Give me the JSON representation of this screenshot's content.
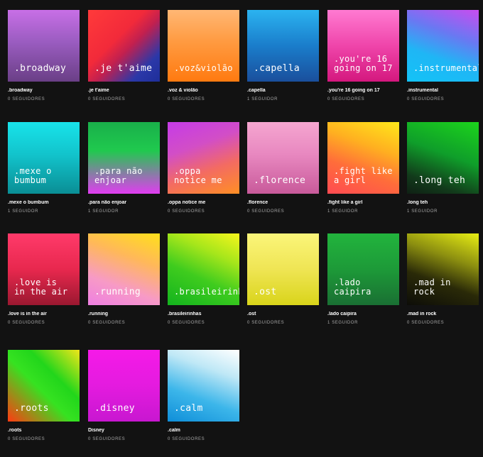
{
  "playlists": [
    {
      "cover": ".broadway",
      "title": ".broadway",
      "followers": "0 SEGUIDORES",
      "bg": "linear-gradient(180deg, #c86fe6 0%, #9a5cc0 45%, #6a3f86 100%)"
    },
    {
      "cover": ".je t'aime",
      "title": ".je t'aime",
      "followers": "0 SEGUIDORES",
      "bg": "linear-gradient(135deg, #ff3a3a 0%, #f22a3a 40%, #c2204f 55%, #2b38a8 80%, #1e2e9a 100%)"
    },
    {
      "cover": ".voz&violão",
      "title": ".voz & violão",
      "followers": "0 SEGUIDORES",
      "bg": "linear-gradient(180deg, #ffb774 0%, #ff9a40 45%, #ff7a10 100%)"
    },
    {
      "cover": ".capella",
      "title": ".capella",
      "followers": "1 SEGUIDOR",
      "bg": "linear-gradient(180deg, #2bb3f0 0%, #1a7dcb 50%, #1a4f9c 100%)"
    },
    {
      "cover": ".you're 16\ngoing on 17",
      "title": ".you're 16 going on 17",
      "followers": "0 SEGUIDORES",
      "bg": "linear-gradient(180deg, #ff7ad1 0%, #ef45aa 50%, #d4187e 100%)"
    },
    {
      "cover": ".instrumental",
      "title": ".instrumental",
      "followers": "0 SEGUIDORES",
      "bg": "linear-gradient(200deg, #c94cf0 0%, #6a78f2 35%, #1fb6f5 65%, #13c3f7 100%)"
    },
    {
      "cover": ".mexe o\nbumbum",
      "title": ".mexe o bumbum",
      "followers": "1 SEGUIDOR",
      "bg": "linear-gradient(180deg, #18e3ea 0%, #12c4cc 45%, #0a8e95 100%)"
    },
    {
      "cover": ".para não\nenjoar",
      "title": ".para não enjoar",
      "followers": "1 SEGUIDOR",
      "bg": "linear-gradient(180deg, #19b04a 0%, #20c94e 40%, #e13cf1 100%)"
    },
    {
      "cover": ".oppa\nnotice me",
      "title": ".oppa notice me",
      "followers": "0 SEGUIDORES",
      "bg": "linear-gradient(160deg, #c63be8 0%, #d24ec6 35%, #f36b62 65%, #ff8f24 100%)"
    },
    {
      "cover": ".florence",
      "title": ".florence",
      "followers": "0 SEGUIDORES",
      "bg": "linear-gradient(180deg, #f5a6d0 0%, #e888c0 45%, #c85a9a 100%)"
    },
    {
      "cover": ".fight like\na girl",
      "title": ".fight like a girl",
      "followers": "1 SEGUIDOR",
      "bg": "linear-gradient(200deg, #ffe81a 0%, #ffb020 35%, #ff6d3a 65%, #ff4a52 100%)"
    },
    {
      "cover": ".long teh",
      "title": ".long teh",
      "followers": "1 SEGUIDOR",
      "bg": "linear-gradient(200deg, #1cd41c 0%, #0f9e2a 45%, #123b1b 80%, #0f2014 100%)"
    },
    {
      "cover": ".love is\nin the air",
      "title": ".love is in the air",
      "followers": "0 SEGUIDORES",
      "bg": "linear-gradient(180deg, #ff3a6a 0%, #e8284e 50%, #9a1830 100%)"
    },
    {
      "cover": ".running",
      "title": ".running",
      "followers": "0 SEGUIDORES",
      "bg": "linear-gradient(200deg, #ffe01a 0%, #ffb85a 35%, #f79ac6 70%, #ee7fe2 100%)"
    },
    {
      "cover": ".brasileirinhas",
      "title": ".brasileirinhas",
      "followers": "0 SEGUIDORES",
      "bg": "linear-gradient(205deg, #f6f51c 0%, #a6e61b 30%, #3fcc1e 60%, #13b31e 100%)"
    },
    {
      "cover": ".ost",
      "title": ".ost",
      "followers": "0 SEGUIDORES",
      "bg": "linear-gradient(180deg, #fbf57a 0%, #efe554 50%, #d9d41a 100%)"
    },
    {
      "cover": ".lado caipira",
      "title": ".lado caipira",
      "followers": "1 SEGUIDOR",
      "bg": "linear-gradient(180deg, #22b43d 0%, #1d9a38 50%, #1a6f33 100%)"
    },
    {
      "cover": ".mad in rock",
      "title": ".mad in rock",
      "followers": "0 SEGUIDORES",
      "bg": "linear-gradient(200deg, #e8ee14 0%, #8c8f10 35%, #2a2a08 65%, #0d0d08 100%)"
    },
    {
      "cover": ".roots",
      "title": ".roots",
      "followers": "0 SEGUIDORES",
      "bg": "linear-gradient(45deg, #ff3a12 0%, #36e221 45%, #22d61b 65%, #f1e61a 100%)"
    },
    {
      "cover": ".disney",
      "title": "Disney",
      "followers": "0 SEGUIDORES",
      "bg": "linear-gradient(180deg, #f51ae8 0%, #e41bdf 50%, #c817d0 100%)"
    },
    {
      "cover": ".calm",
      "title": ".calm",
      "followers": "0 SEGUIDORES",
      "bg": "linear-gradient(200deg, #ffffff 0%, #bfe8f6 30%, #3cb6ea 65%, #0f8ed8 100%)"
    }
  ]
}
